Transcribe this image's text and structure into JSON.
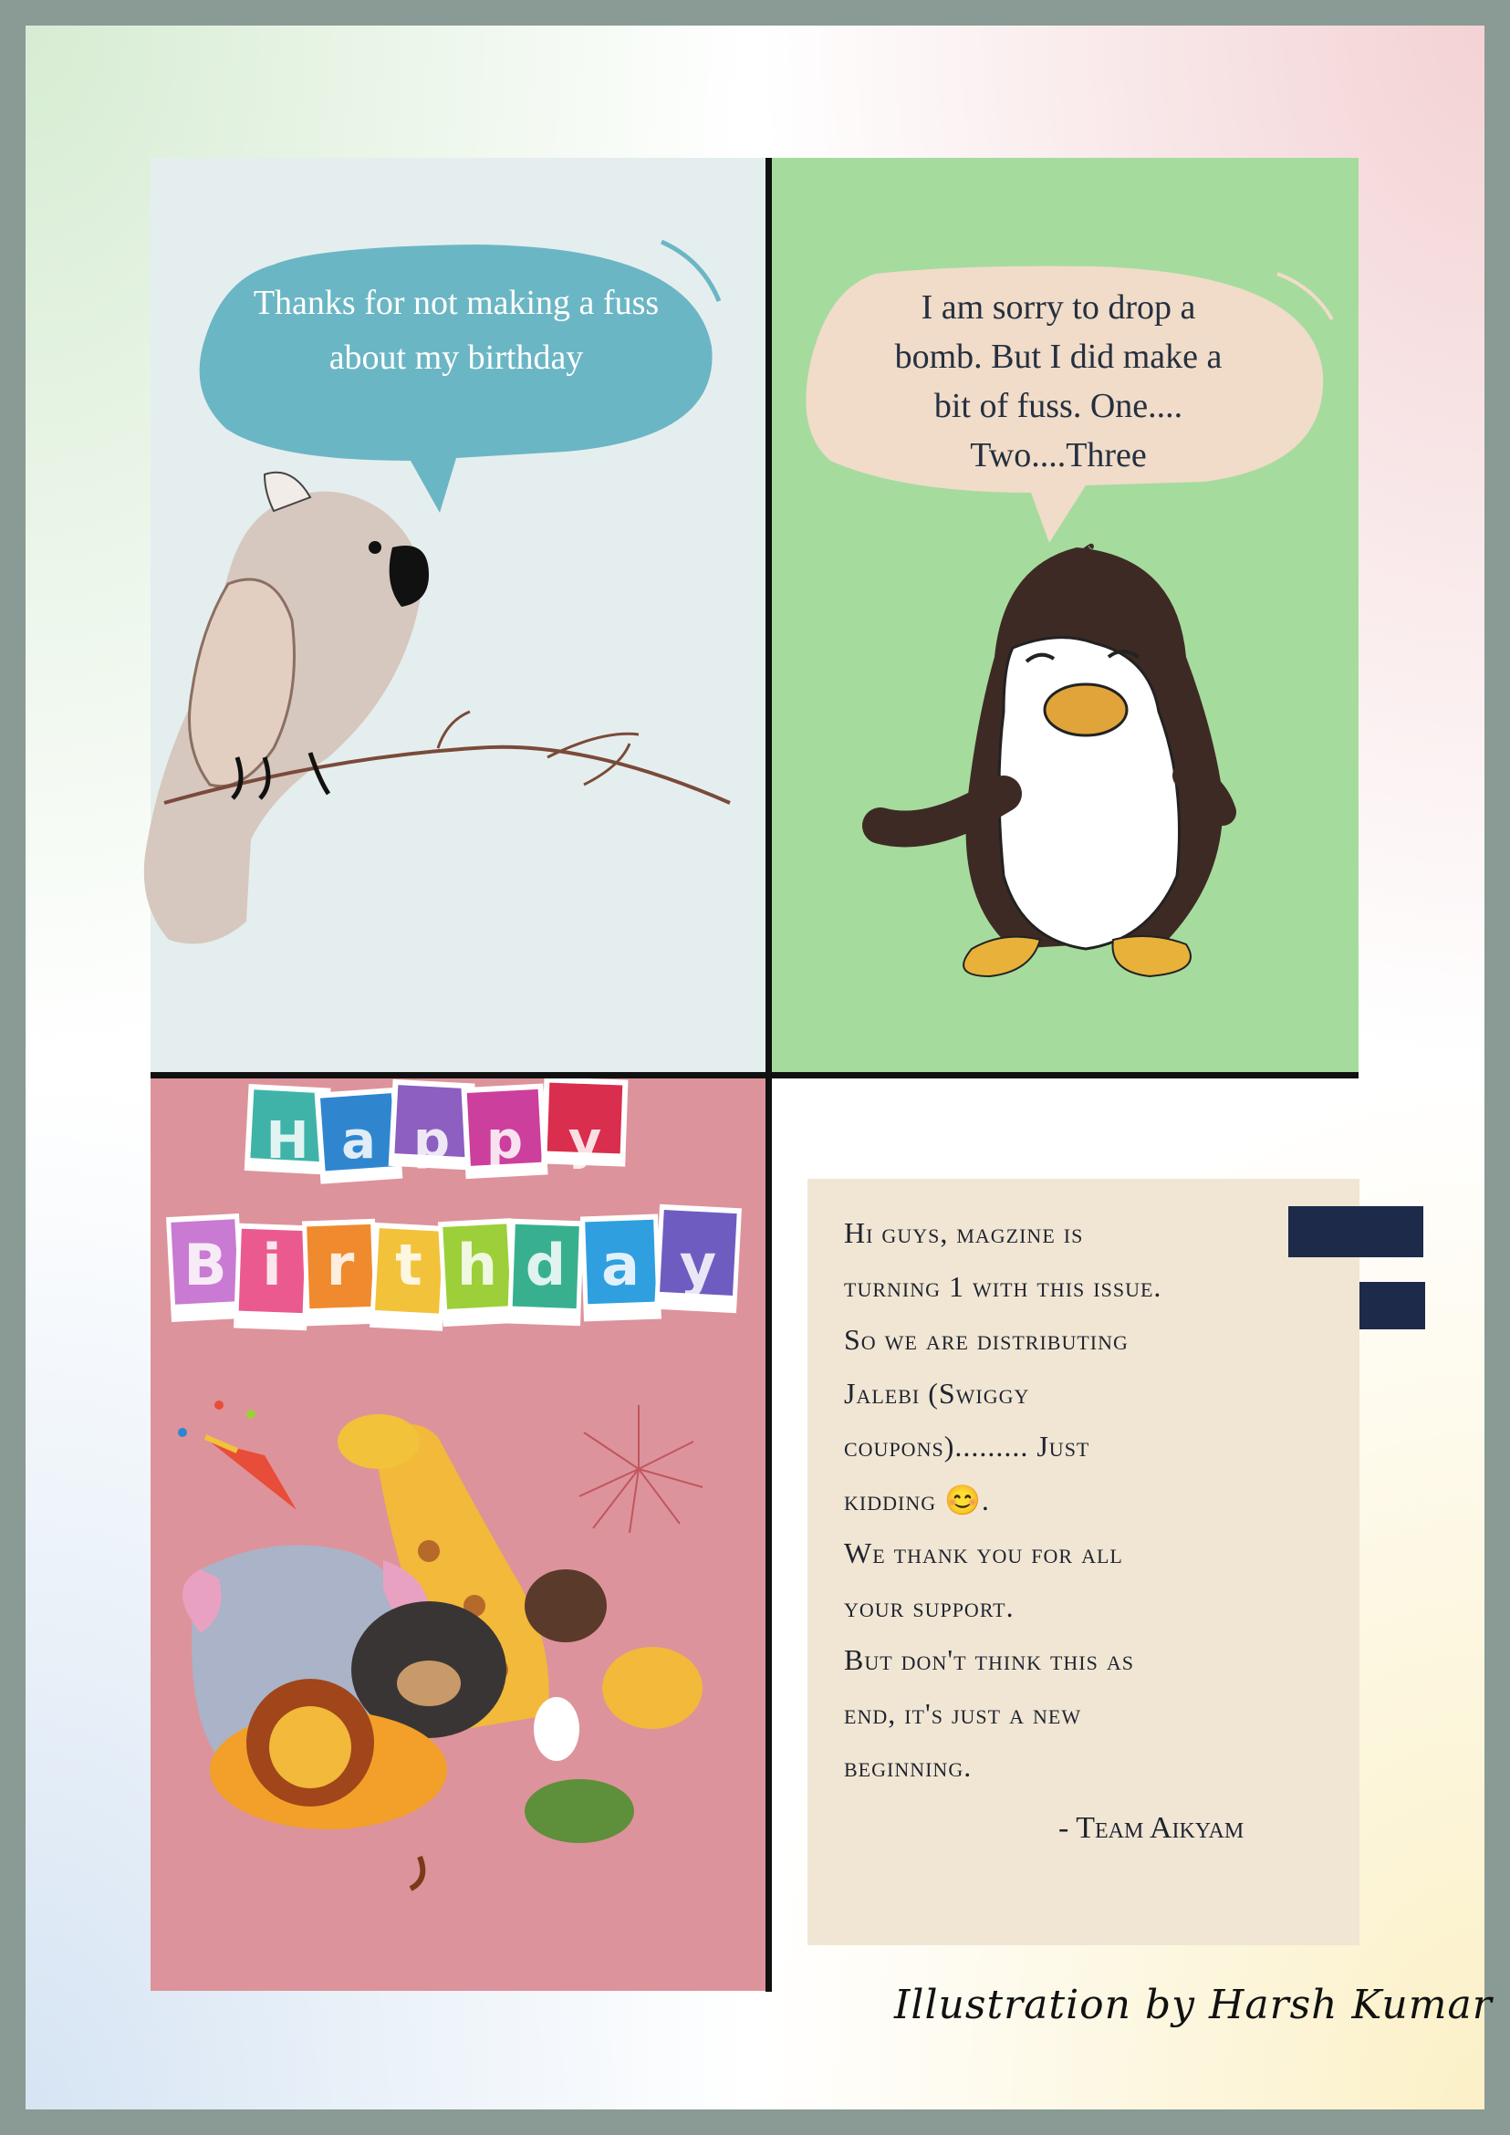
{
  "panels": {
    "cockatoo": {
      "speech": "Thanks for not making a fuss about my birthday"
    },
    "penguin": {
      "speech": "I am sorry to drop a bomb.  But I did make a bit of  fuss. One.... Two....Three"
    },
    "birthday": {
      "happy_letters": [
        "H",
        "a",
        "p",
        "p",
        "y"
      ],
      "birthday_letters": [
        "B",
        "i",
        "r",
        "t",
        "h",
        "d",
        "a",
        "y"
      ]
    }
  },
  "note": {
    "lines": [
      "Hi guys, magzine is",
      "turning 1 with this issue.",
      "So we are distributing",
      "Jalebi (Swiggy",
      "coupons)......... Just",
      "kidding 😊.",
      "We thank you for all",
      "your support.",
      "But don't think this as",
      "end, it's just a new",
      "beginning."
    ],
    "signature": "- Team Aikyam"
  },
  "credit": "Illustration by Harsh Kumar",
  "colors": {
    "frame": "#8a9a94",
    "cockatoo_bg": "#e5eeee",
    "penguin_bg": "#a6db9e",
    "birthday_bg": "#dd939b",
    "note_bg": "#f0e6d3",
    "bubble_blue": "#6bb6c4",
    "bubble_peach": "#f0dcc8"
  }
}
